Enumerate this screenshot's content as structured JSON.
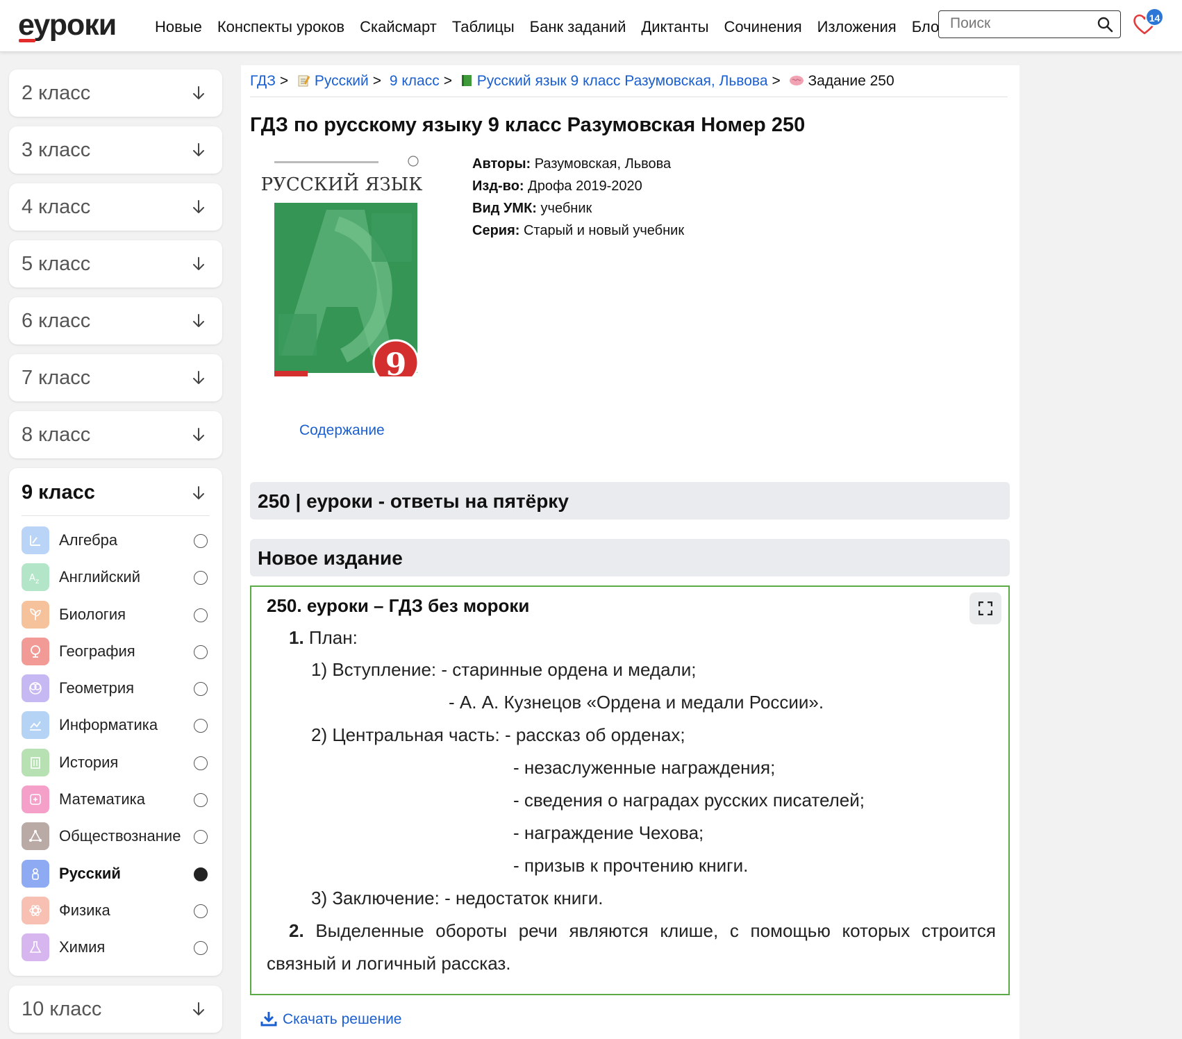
{
  "header": {
    "logo": "еуроки",
    "nav": [
      "Новые",
      "Конспекты уроков",
      "Скайсмарт",
      "Таблицы",
      "Банк заданий",
      "Диктанты",
      "Сочинения",
      "Изложения",
      "Блог"
    ],
    "search_placeholder": "Поиск",
    "favorites_count": "14"
  },
  "sidebar": {
    "grades_top": [
      "2 класс",
      "3 класс",
      "4 класс",
      "5 класс",
      "6 класс",
      "7 класс",
      "8 класс"
    ],
    "open_grade": "9 класс",
    "subjects": [
      {
        "name": "Алгебра",
        "color": "#b9d4f7"
      },
      {
        "name": "Английский",
        "color": "#b3e6c8"
      },
      {
        "name": "Биология",
        "color": "#f5c29c"
      },
      {
        "name": "География",
        "color": "#f29a95"
      },
      {
        "name": "Геометрия",
        "color": "#c6b8f2"
      },
      {
        "name": "Информатика",
        "color": "#b4d3f5"
      },
      {
        "name": "История",
        "color": "#b7e0b3"
      },
      {
        "name": "Математика",
        "color": "#f4a0c8"
      },
      {
        "name": "Обществознание",
        "color": "#b9aaa5"
      },
      {
        "name": "Русский",
        "color": "#8eaaf2",
        "active": true
      },
      {
        "name": "Физика",
        "color": "#f7c0b3"
      },
      {
        "name": "Химия",
        "color": "#d7b5ef"
      }
    ],
    "grade_bottom": "10 класс"
  },
  "breadcrumb": {
    "root": "ГДЗ",
    "subject": "Русский",
    "grade": "9 класс",
    "book": "Русский язык 9 класс Разумовская, Львова",
    "current": "Задание 250",
    "sep": ">"
  },
  "page_title": "ГДЗ по русскому языку 9 класс Разумовская Номер 250",
  "book": {
    "cover_title": "РУССКИЙ ЯЗЫК",
    "cover_number": "9",
    "contents_link": "Содержание",
    "meta": [
      {
        "label": "Авторы:",
        "value": " Разумовская, Львова"
      },
      {
        "label": "Изд-во:",
        "value": " Дрофа 2019-2020"
      },
      {
        "label": "Вид УМК:",
        "value": " учебник"
      },
      {
        "label": "Серия:",
        "value": " Старый и новый учебник"
      }
    ]
  },
  "bars": {
    "answers": "250 | еуроки - ответы на пятёрку",
    "edition": "Новое издание"
  },
  "answer": {
    "heading": "250. еуроки – ГДЗ без мороки",
    "n1": "1.",
    "plan": " План:",
    "l1": "1) Вступление: - старинные ордена и медали;",
    "l2": "- А. А. Кузнецов «Ордена и медали России».",
    "l3": "2) Центральная часть: - рассказ об орденах;",
    "l4": "- незаслуженные награждения;",
    "l5": "- сведения о наградах русских писателей;",
    "l6": "- награждение Чехова;",
    "l7": "- призыв к прочтению книги.",
    "l8": "3) Заключение: - недостаток книги.",
    "n2": "2.",
    "l9a": " Выделенные обороты речи являются клише, с помощью которых строится",
    "l9b": "связный и логичный рассказ."
  },
  "download": "Скачать решение"
}
